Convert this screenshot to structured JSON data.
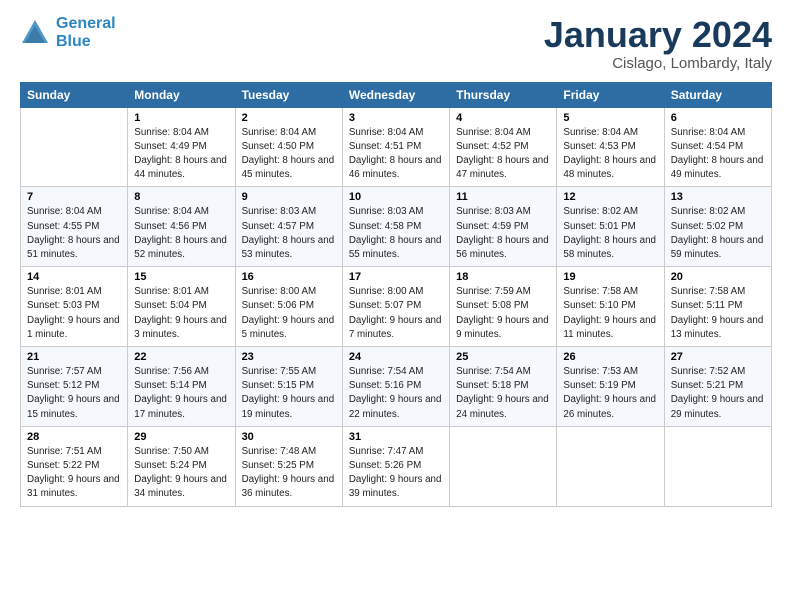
{
  "logo": {
    "line1": "General",
    "line2": "Blue"
  },
  "title": "January 2024",
  "location": "Cislago, Lombardy, Italy",
  "weekdays": [
    "Sunday",
    "Monday",
    "Tuesday",
    "Wednesday",
    "Thursday",
    "Friday",
    "Saturday"
  ],
  "weeks": [
    [
      {
        "day": "",
        "sunrise": "",
        "sunset": "",
        "daylight": ""
      },
      {
        "day": "1",
        "sunrise": "Sunrise: 8:04 AM",
        "sunset": "Sunset: 4:49 PM",
        "daylight": "Daylight: 8 hours and 44 minutes."
      },
      {
        "day": "2",
        "sunrise": "Sunrise: 8:04 AM",
        "sunset": "Sunset: 4:50 PM",
        "daylight": "Daylight: 8 hours and 45 minutes."
      },
      {
        "day": "3",
        "sunrise": "Sunrise: 8:04 AM",
        "sunset": "Sunset: 4:51 PM",
        "daylight": "Daylight: 8 hours and 46 minutes."
      },
      {
        "day": "4",
        "sunrise": "Sunrise: 8:04 AM",
        "sunset": "Sunset: 4:52 PM",
        "daylight": "Daylight: 8 hours and 47 minutes."
      },
      {
        "day": "5",
        "sunrise": "Sunrise: 8:04 AM",
        "sunset": "Sunset: 4:53 PM",
        "daylight": "Daylight: 8 hours and 48 minutes."
      },
      {
        "day": "6",
        "sunrise": "Sunrise: 8:04 AM",
        "sunset": "Sunset: 4:54 PM",
        "daylight": "Daylight: 8 hours and 49 minutes."
      }
    ],
    [
      {
        "day": "7",
        "sunrise": "Sunrise: 8:04 AM",
        "sunset": "Sunset: 4:55 PM",
        "daylight": "Daylight: 8 hours and 51 minutes."
      },
      {
        "day": "8",
        "sunrise": "Sunrise: 8:04 AM",
        "sunset": "Sunset: 4:56 PM",
        "daylight": "Daylight: 8 hours and 52 minutes."
      },
      {
        "day": "9",
        "sunrise": "Sunrise: 8:03 AM",
        "sunset": "Sunset: 4:57 PM",
        "daylight": "Daylight: 8 hours and 53 minutes."
      },
      {
        "day": "10",
        "sunrise": "Sunrise: 8:03 AM",
        "sunset": "Sunset: 4:58 PM",
        "daylight": "Daylight: 8 hours and 55 minutes."
      },
      {
        "day": "11",
        "sunrise": "Sunrise: 8:03 AM",
        "sunset": "Sunset: 4:59 PM",
        "daylight": "Daylight: 8 hours and 56 minutes."
      },
      {
        "day": "12",
        "sunrise": "Sunrise: 8:02 AM",
        "sunset": "Sunset: 5:01 PM",
        "daylight": "Daylight: 8 hours and 58 minutes."
      },
      {
        "day": "13",
        "sunrise": "Sunrise: 8:02 AM",
        "sunset": "Sunset: 5:02 PM",
        "daylight": "Daylight: 8 hours and 59 minutes."
      }
    ],
    [
      {
        "day": "14",
        "sunrise": "Sunrise: 8:01 AM",
        "sunset": "Sunset: 5:03 PM",
        "daylight": "Daylight: 9 hours and 1 minute."
      },
      {
        "day": "15",
        "sunrise": "Sunrise: 8:01 AM",
        "sunset": "Sunset: 5:04 PM",
        "daylight": "Daylight: 9 hours and 3 minutes."
      },
      {
        "day": "16",
        "sunrise": "Sunrise: 8:00 AM",
        "sunset": "Sunset: 5:06 PM",
        "daylight": "Daylight: 9 hours and 5 minutes."
      },
      {
        "day": "17",
        "sunrise": "Sunrise: 8:00 AM",
        "sunset": "Sunset: 5:07 PM",
        "daylight": "Daylight: 9 hours and 7 minutes."
      },
      {
        "day": "18",
        "sunrise": "Sunrise: 7:59 AM",
        "sunset": "Sunset: 5:08 PM",
        "daylight": "Daylight: 9 hours and 9 minutes."
      },
      {
        "day": "19",
        "sunrise": "Sunrise: 7:58 AM",
        "sunset": "Sunset: 5:10 PM",
        "daylight": "Daylight: 9 hours and 11 minutes."
      },
      {
        "day": "20",
        "sunrise": "Sunrise: 7:58 AM",
        "sunset": "Sunset: 5:11 PM",
        "daylight": "Daylight: 9 hours and 13 minutes."
      }
    ],
    [
      {
        "day": "21",
        "sunrise": "Sunrise: 7:57 AM",
        "sunset": "Sunset: 5:12 PM",
        "daylight": "Daylight: 9 hours and 15 minutes."
      },
      {
        "day": "22",
        "sunrise": "Sunrise: 7:56 AM",
        "sunset": "Sunset: 5:14 PM",
        "daylight": "Daylight: 9 hours and 17 minutes."
      },
      {
        "day": "23",
        "sunrise": "Sunrise: 7:55 AM",
        "sunset": "Sunset: 5:15 PM",
        "daylight": "Daylight: 9 hours and 19 minutes."
      },
      {
        "day": "24",
        "sunrise": "Sunrise: 7:54 AM",
        "sunset": "Sunset: 5:16 PM",
        "daylight": "Daylight: 9 hours and 22 minutes."
      },
      {
        "day": "25",
        "sunrise": "Sunrise: 7:54 AM",
        "sunset": "Sunset: 5:18 PM",
        "daylight": "Daylight: 9 hours and 24 minutes."
      },
      {
        "day": "26",
        "sunrise": "Sunrise: 7:53 AM",
        "sunset": "Sunset: 5:19 PM",
        "daylight": "Daylight: 9 hours and 26 minutes."
      },
      {
        "day": "27",
        "sunrise": "Sunrise: 7:52 AM",
        "sunset": "Sunset: 5:21 PM",
        "daylight": "Daylight: 9 hours and 29 minutes."
      }
    ],
    [
      {
        "day": "28",
        "sunrise": "Sunrise: 7:51 AM",
        "sunset": "Sunset: 5:22 PM",
        "daylight": "Daylight: 9 hours and 31 minutes."
      },
      {
        "day": "29",
        "sunrise": "Sunrise: 7:50 AM",
        "sunset": "Sunset: 5:24 PM",
        "daylight": "Daylight: 9 hours and 34 minutes."
      },
      {
        "day": "30",
        "sunrise": "Sunrise: 7:48 AM",
        "sunset": "Sunset: 5:25 PM",
        "daylight": "Daylight: 9 hours and 36 minutes."
      },
      {
        "day": "31",
        "sunrise": "Sunrise: 7:47 AM",
        "sunset": "Sunset: 5:26 PM",
        "daylight": "Daylight: 9 hours and 39 minutes."
      },
      {
        "day": "",
        "sunrise": "",
        "sunset": "",
        "daylight": ""
      },
      {
        "day": "",
        "sunrise": "",
        "sunset": "",
        "daylight": ""
      },
      {
        "day": "",
        "sunrise": "",
        "sunset": "",
        "daylight": ""
      }
    ]
  ]
}
